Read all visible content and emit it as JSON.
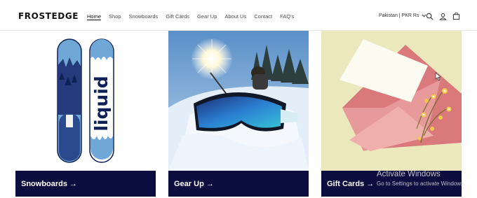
{
  "header": {
    "logo": "FROSTEDGE",
    "nav": [
      {
        "label": "Home",
        "active": true
      },
      {
        "label": "Shop"
      },
      {
        "label": "Snowboards"
      },
      {
        "label": "Gift Cards"
      },
      {
        "label": "Gear Up"
      },
      {
        "label": "About Us"
      },
      {
        "label": "Contact"
      },
      {
        "label": "FAQ's"
      }
    ],
    "region": "Pakistan | PKR Rs",
    "icons": [
      "search-icon",
      "account-icon",
      "cart-icon"
    ]
  },
  "collections": [
    {
      "label": "Snowboards →",
      "board_text": "liquid"
    },
    {
      "label": "Gear Up →"
    },
    {
      "label": "Gift Cards →"
    }
  ],
  "watermark": {
    "title": "Activate Windows",
    "subtitle": "Go to Settings to activate Windows."
  },
  "colors": {
    "label_bg": "#0a0d3d",
    "gift_bg": "#ece8bd"
  }
}
